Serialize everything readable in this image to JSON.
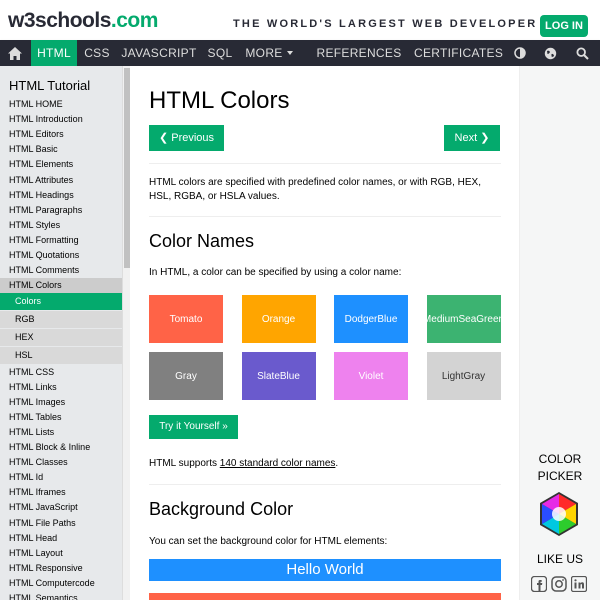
{
  "header": {
    "logo_main": "w3schools",
    "logo_suffix": ".com",
    "tagline": "THE WORLD'S LARGEST WEB DEVELOPER SITE",
    "login_label": "LOG IN"
  },
  "navbar": {
    "home_icon": "home-icon",
    "items": [
      "HTML",
      "CSS",
      "JAVASCRIPT",
      "SQL",
      "MORE",
      "REFERENCES",
      "CERTIFICATES"
    ],
    "active": "HTML",
    "right_icons": [
      "contrast-icon",
      "globe-icon",
      "search-icon"
    ]
  },
  "sidebar": {
    "title": "HTML Tutorial",
    "links_top": [
      "HTML HOME",
      "HTML Introduction",
      "HTML Editors",
      "HTML Basic",
      "HTML Elements",
      "HTML Attributes",
      "HTML Headings",
      "HTML Paragraphs",
      "HTML Styles",
      "HTML Formatting",
      "HTML Quotations",
      "HTML Comments"
    ],
    "section": "HTML Colors",
    "sub_links": [
      "Colors",
      "RGB",
      "HEX",
      "HSL"
    ],
    "current_sub": "Colors",
    "links_bottom": [
      "HTML CSS",
      "HTML Links",
      "HTML Images",
      "HTML Tables",
      "HTML Lists",
      "HTML Block & Inline",
      "HTML Classes",
      "HTML Id",
      "HTML Iframes",
      "HTML JavaScript",
      "HTML File Paths",
      "HTML Head",
      "HTML Layout",
      "HTML Responsive",
      "HTML Computercode",
      "HTML Semantics"
    ]
  },
  "main": {
    "title": "HTML Colors",
    "prev_label": "❮ Previous",
    "next_label": "Next ❯",
    "intro": "HTML colors are specified with predefined color names, or with RGB, HEX, HSL, RGBA, or HSLA values.",
    "color_names_heading": "Color Names",
    "color_names_text": "In HTML, a color can be specified by using a color name:",
    "swatches": [
      {
        "name": "Tomato",
        "color": "#ff6347"
      },
      {
        "name": "Orange",
        "color": "#ffa500"
      },
      {
        "name": "DodgerBlue",
        "color": "#1e90ff"
      },
      {
        "name": "MediumSeaGreen",
        "color": "#3cb371"
      },
      {
        "name": "Gray",
        "color": "#808080"
      },
      {
        "name": "SlateBlue",
        "color": "#6a5acd"
      },
      {
        "name": "Violet",
        "color": "#ee82ee"
      },
      {
        "name": "LightGray",
        "color": "#d3d3d3",
        "text_color": "#333333"
      }
    ],
    "try_label": "Try it Yourself »",
    "support_prefix": "HTML supports ",
    "support_link": "140 standard color names",
    "support_suffix": ".",
    "bg_heading": "Background Color",
    "bg_text": "You can set the background color for HTML elements:",
    "hello_text": "Hello World"
  },
  "rightcol": {
    "color_picker_label": "COLOR PICKER",
    "like_label": "LIKE US",
    "social_icons": [
      "facebook-icon",
      "instagram-icon",
      "linkedin-icon"
    ]
  },
  "colors": {
    "brand_green": "#04aa6d",
    "nav_dark": "#282a35",
    "sidebar_bg": "#e7e9eb"
  }
}
